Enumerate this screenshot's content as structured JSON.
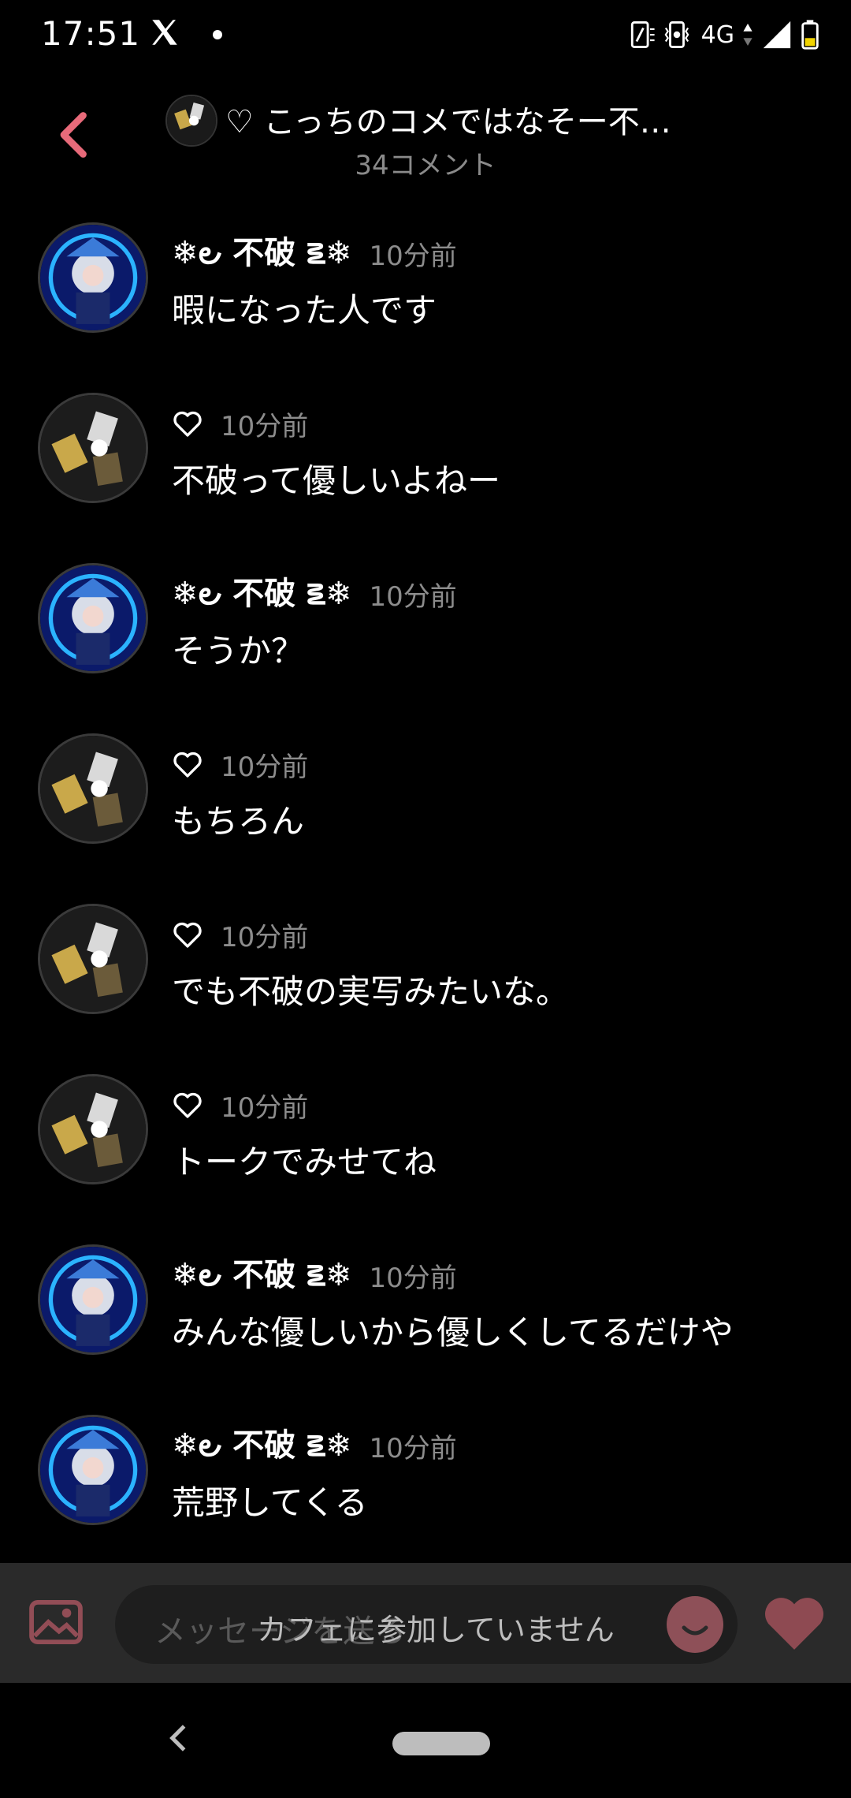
{
  "status_bar": {
    "time": "17:51",
    "network": "4G",
    "icons": [
      "x-app-icon",
      "notification-dot-icon",
      "nfc-icon",
      "vibrate-icon",
      "data-arrows-icon",
      "signal-icon",
      "battery-icon"
    ]
  },
  "header": {
    "title": "♡ こっちのコメではなそー不…",
    "comment_count": "34コメント"
  },
  "comments": [
    {
      "author": "❄︎౿ 不破 ౾❄︎",
      "time": "10分前",
      "text": "暇になった人です",
      "avatar": "anime-avatar"
    },
    {
      "author": "",
      "time": "10分前",
      "text": "不破って優しいよねー",
      "avatar": "photo-avatar"
    },
    {
      "author": "❄︎౿ 不破 ౾❄︎",
      "time": "10分前",
      "text": "そうか？",
      "avatar": "anime-avatar"
    },
    {
      "author": "",
      "time": "10分前",
      "text": "もちろん",
      "avatar": "photo-avatar"
    },
    {
      "author": "",
      "time": "10分前",
      "text": "でも不破の実写みたいな。",
      "avatar": "photo-avatar"
    },
    {
      "author": "",
      "time": "10分前",
      "text": "トークでみせてね",
      "avatar": "photo-avatar"
    },
    {
      "author": "❄︎౿ 不破 ౾❄︎",
      "time": "10分前",
      "text": "みんな優しいから優しくしてるだけや",
      "avatar": "anime-avatar"
    },
    {
      "author": "❄︎౿ 不破 ౾❄︎",
      "time": "10分前",
      "text": "荒野してくる",
      "avatar": "anime-avatar"
    }
  ],
  "input_bar": {
    "placeholder": "メッセージを送る",
    "disabled_notice": "カフェに参加していません"
  },
  "colors": {
    "background": "#000000",
    "accent_pink": "#e86a7a",
    "muted_text": "#8c8c8c",
    "input_bg": "#2a2a2a",
    "heart_button": "#8e4a52"
  }
}
